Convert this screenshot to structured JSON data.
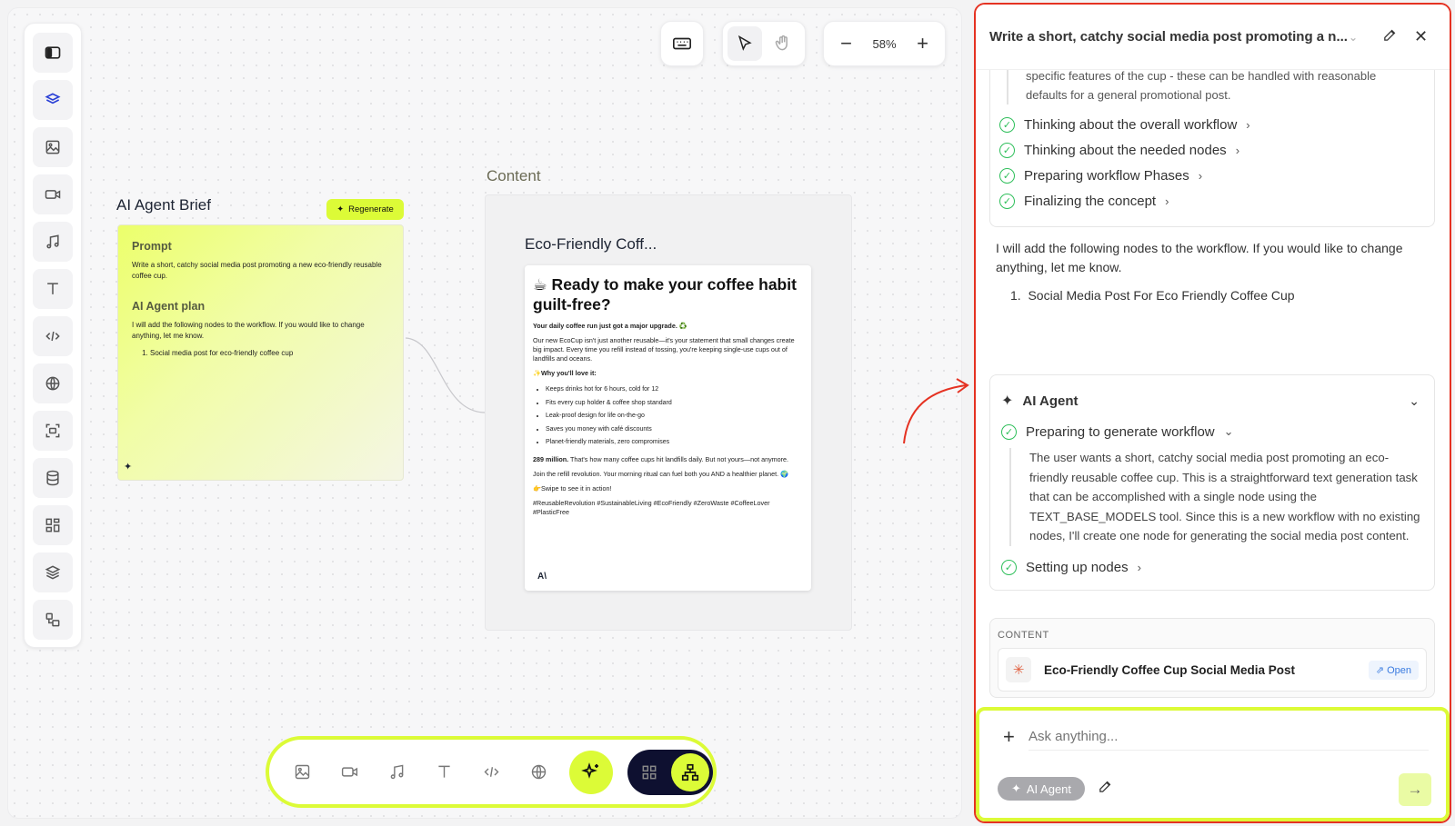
{
  "toolbar": {
    "zoom": "58%"
  },
  "nodes": {
    "brief_title": "AI Agent Brief",
    "regenerate_label": "Regenerate",
    "prompt_heading": "Prompt",
    "prompt_text": "Write a short, catchy social media post promoting a new eco-friendly reusable coffee cup.",
    "plan_heading": "AI Agent plan",
    "plan_text": "I will add the following nodes to the workflow. If you would like to change anything, let me know.",
    "plan_item": "Social media post for eco-friendly coffee cup",
    "content_title": "Content",
    "doc_title": "Eco-Friendly Coff..."
  },
  "doc": {
    "headline": "☕ Ready to make your coffee habit guilt-free?",
    "subhead": "Your daily coffee run just got a major upgrade. ♻️",
    "intro": "Our new EcoCup isn't just another reusable—it's your statement that small changes create big impact. Every time you refill instead of tossing, you're keeping single-use cups out of landfills and oceans.",
    "why_label": "✨Why you'll love it:",
    "bullets": [
      "Keeps drinks hot for 6 hours, cold for 12",
      "Fits every cup holder & coffee shop standard",
      "Leak-proof design for life on-the-go",
      "Saves you money with café discounts",
      "Planet-friendly materials, zero compromises"
    ],
    "stat_bold": "289 million.",
    "stat": " That's how many coffee cups hit landfills daily. But not yours—not anymore.",
    "join": "Join the refill revolution. Your morning ritual can fuel both you AND a healthier planet. 🌍",
    "swipe": "👉Swipe to see it in action!",
    "tags": "#ReusableRevolution #SustainableLiving #EcoFriendly #ZeroWaste #CoffeeLover #PlasticFree",
    "logo": "A\\"
  },
  "panel": {
    "title": "Write a short, catchy social media post promoting a n...",
    "top_text": "specific features of the cup - these can be handled with reasonable defaults for a general promotional post.",
    "steps": [
      "Thinking about the overall workflow",
      "Thinking about the needed nodes",
      "Preparing workflow Phases",
      "Finalizing the concept"
    ],
    "message": "I will add the following nodes to the workflow. If you would like to change anything, let me know.",
    "message_item": "Social Media Post For Eco Friendly Coffee Cup",
    "agent_title": "AI Agent",
    "agent_step": "Preparing to generate workflow",
    "agent_thought": "The user wants a short, catchy social media post promoting an eco-friendly reusable coffee cup. This is a straightforward text generation task that can be accomplished with a single node using the TEXT_BASE_MODELS tool. Since this is a new workflow with no existing nodes, I'll create one node for generating the social media post content.",
    "agent_step2": "Setting up nodes",
    "content_label": "CONTENT",
    "content_item": "Eco-Friendly Coffee Cup Social Media Post",
    "open_label": "Open",
    "ask_placeholder": "Ask anything...",
    "chip_label": "AI Agent"
  },
  "colors": {
    "accent_lime": "#dcfb37",
    "annotation_red": "#e53222",
    "check_green": "#2fbf5b"
  }
}
